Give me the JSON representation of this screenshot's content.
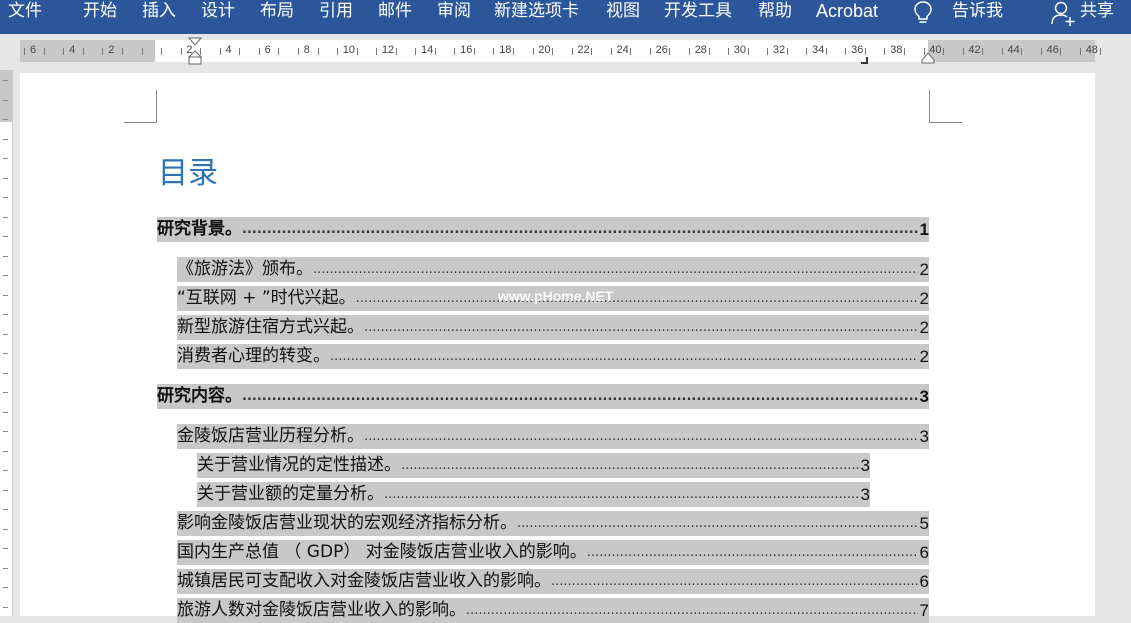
{
  "ribbon": {
    "tabs": [
      {
        "id": "file",
        "label": "文件"
      },
      {
        "id": "home",
        "label": "开始"
      },
      {
        "id": "insert",
        "label": "插入"
      },
      {
        "id": "design",
        "label": "设计"
      },
      {
        "id": "layout",
        "label": "布局"
      },
      {
        "id": "references",
        "label": "引用"
      },
      {
        "id": "mailings",
        "label": "邮件"
      },
      {
        "id": "review",
        "label": "审阅"
      },
      {
        "id": "newtab",
        "label": "新建选项卡"
      },
      {
        "id": "view",
        "label": "视图"
      },
      {
        "id": "developer",
        "label": "开发工具"
      },
      {
        "id": "help",
        "label": "帮助"
      },
      {
        "id": "acrobat",
        "label": "Acrobat"
      }
    ],
    "tell_me": "告诉我",
    "share": "共享",
    "bulb_icon": "lightbulb-icon",
    "share_icon": "person-add-icon",
    "bar_color": "#2b579a"
  },
  "ruler": {
    "numbers": [
      "6",
      "4",
      "2",
      "",
      "2",
      "4",
      "6",
      "8",
      "10",
      "12",
      "14",
      "16",
      "18",
      "20",
      "22",
      "24",
      "26",
      "28",
      "30",
      "32",
      "34",
      "36",
      "38",
      "40",
      "42",
      "44",
      "46",
      "48"
    ]
  },
  "document": {
    "toc_title": "目录",
    "title_color": "#2e74b5",
    "watermark": "www.pHome.NET",
    "entries": [
      {
        "level": 1,
        "text": "研究背景。",
        "page": "1"
      },
      {
        "level": 2,
        "text": "《旅游法》颁布。",
        "page": "2"
      },
      {
        "level": 2,
        "text": "“互联网 + ”时代兴起。",
        "page": "2"
      },
      {
        "level": 2,
        "text": "新型旅游住宿方式兴起。",
        "page": "2"
      },
      {
        "level": 2,
        "text": "消费者心理的转变。",
        "page": "2"
      },
      {
        "level": 1,
        "text": "研究内容。",
        "page": "3"
      },
      {
        "level": 2,
        "text": "金陵饭店营业历程分析。",
        "page": "3"
      },
      {
        "level": 3,
        "text": "关于营业情况的定性描述。",
        "page": "3"
      },
      {
        "level": 3,
        "text": "关于营业额的定量分析。",
        "page": "3"
      },
      {
        "level": 2,
        "text": "影响金陵饭店营业现状的宏观经济指标分析。",
        "page": "5"
      },
      {
        "level": 2,
        "text": "国内生产总值 （ GDP） 对金陵饭店营业收入的影响。",
        "page": "6"
      },
      {
        "level": 2,
        "text": "城镇居民可支配收入对金陵饭店营业收入的影响。",
        "page": "6"
      },
      {
        "level": 2,
        "text": "旅游人数对金陵饭店营业收入的影响。",
        "page": "7"
      }
    ]
  }
}
